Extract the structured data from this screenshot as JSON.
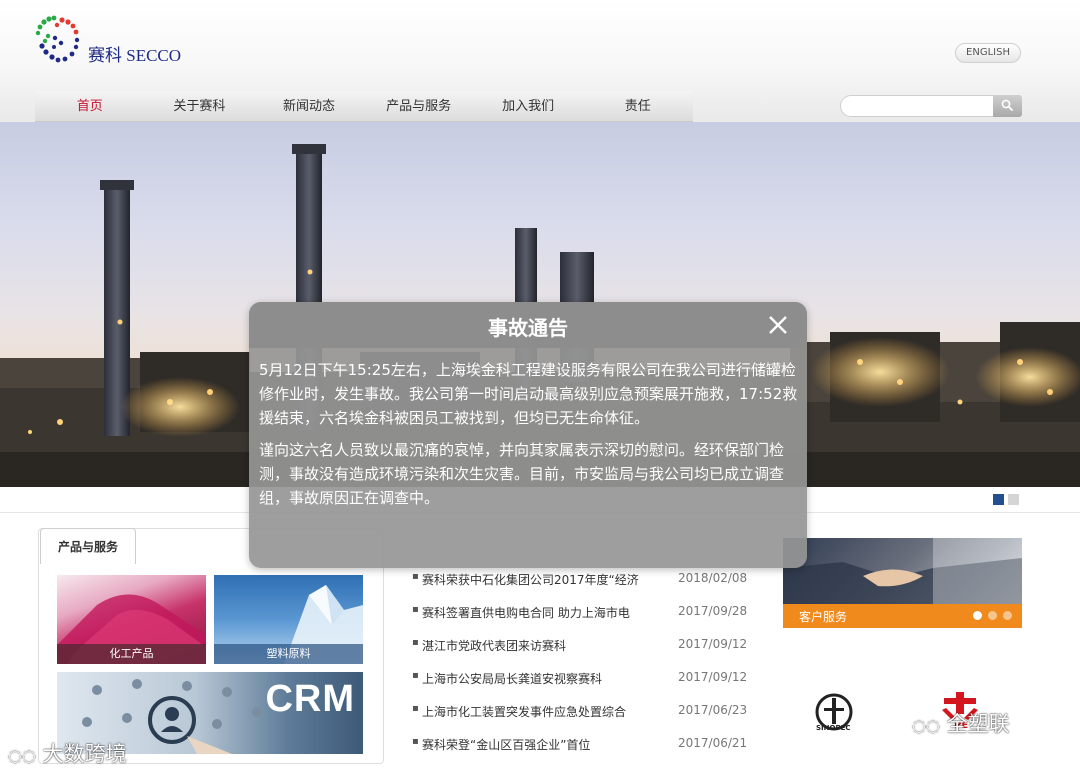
{
  "header": {
    "logo_text": "赛科 SECCO",
    "lang_button": "ENGLISH",
    "search_placeholder": ""
  },
  "nav": {
    "items": [
      {
        "label": "首页",
        "active": true
      },
      {
        "label": "关于赛科"
      },
      {
        "label": "新闻动态"
      },
      {
        "label": "产品与服务"
      },
      {
        "label": "加入我们"
      },
      {
        "label": "责任"
      }
    ]
  },
  "banner": {
    "slides": 2,
    "active_slide": 1
  },
  "modal": {
    "title": "事故通告",
    "paragraphs": [
      "5月12日下午15:25左右，上海埃金科工程建设服务有限公司在我公司进行储罐检修作业时，发生事故。我公司第一时间启动最高级别应急预案展开施救，17:52救援结束，六名埃金科被困员工被找到，但均已无生命体征。",
      "谨向这六名人员致以最沉痛的哀悼，并向其家属表示深切的慰问。经环保部门检测，事故没有造成环境污染和次生灾害。目前，市安监局与我公司均已成立调查组，事故原因正在调查中。"
    ]
  },
  "products": {
    "tab_label": "产品与服务",
    "tiles": [
      {
        "label": "化工产品"
      },
      {
        "label": "塑料原料"
      },
      {
        "label": "CRM"
      }
    ]
  },
  "news": {
    "items": [
      {
        "title": "赛科荣获中石化集团公司2017年度“经济",
        "date": "2018/02/08"
      },
      {
        "title": "赛科签署直供电购电合同 助力上海市电",
        "date": "2017/09/28"
      },
      {
        "title": "湛江市党政代表团来访赛科",
        "date": "2017/09/12"
      },
      {
        "title": "上海市公安局局长龚道安视察赛科",
        "date": "2017/09/12"
      },
      {
        "title": "上海市化工装置突发事件应急处置综合",
        "date": "2017/06/23"
      },
      {
        "title": "赛科荣登“金山区百强企业”首位",
        "date": "2017/06/21"
      }
    ]
  },
  "customer_service": {
    "label": "客户服务"
  },
  "partners": {
    "sinopec_text": "SINOPEC",
    "second_text": "PE"
  },
  "watermarks": {
    "left": "大数跨境",
    "right": "全塑联"
  },
  "colors": {
    "nav_active": "#c8102e",
    "logo_blue": "#1e2a86",
    "slide_active": "#244f8e",
    "customer_service_orange": "#f08a1c",
    "modal_bg": "#969696"
  }
}
